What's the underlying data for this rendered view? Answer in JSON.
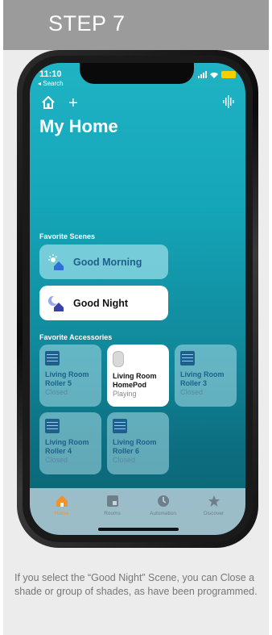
{
  "step": {
    "label": "STEP 7"
  },
  "status_bar": {
    "time": "11:10",
    "back_label": "◂ Search"
  },
  "header": {
    "title": "My Home"
  },
  "scenes": {
    "section_label": "Favorite Scenes",
    "items": [
      {
        "label": "Good Morning",
        "active": false
      },
      {
        "label": "Good Night",
        "active": true
      }
    ]
  },
  "accessories": {
    "section_label": "Favorite Accessories",
    "items": [
      {
        "name_line1": "Living Room",
        "name_line2": "Roller 5",
        "state": "Closed",
        "type": "shade",
        "active": false
      },
      {
        "name_line1": "Living Room",
        "name_line2": "HomePod",
        "state": "Playing",
        "type": "homepod",
        "active": true
      },
      {
        "name_line1": "Living Room",
        "name_line2": "Roller 3",
        "state": "Closed",
        "type": "shade",
        "active": false
      },
      {
        "name_line1": "Living Room",
        "name_line2": "Roller 4",
        "state": "Closed",
        "type": "shade",
        "active": false
      },
      {
        "name_line1": "Living Room",
        "name_line2": "Roller 6",
        "state": "Closed",
        "type": "shade",
        "active": false
      }
    ]
  },
  "tabbar": {
    "tabs": [
      {
        "label": "Home",
        "icon": "house-icon",
        "active": true
      },
      {
        "label": "Rooms",
        "icon": "rooms-icon",
        "active": false
      },
      {
        "label": "Automation",
        "icon": "clock-icon",
        "active": false
      },
      {
        "label": "Discover",
        "icon": "star-icon",
        "active": false
      }
    ]
  },
  "caption": {
    "text": "If you select the “Good Night” Scene, you can Close a shade or group of shades, as have been programmed."
  },
  "colors": {
    "header_gray": "#9b9b9b",
    "teal": "#15a6b9",
    "active_tab": "#f0932b",
    "card_bg": "#ececec"
  }
}
